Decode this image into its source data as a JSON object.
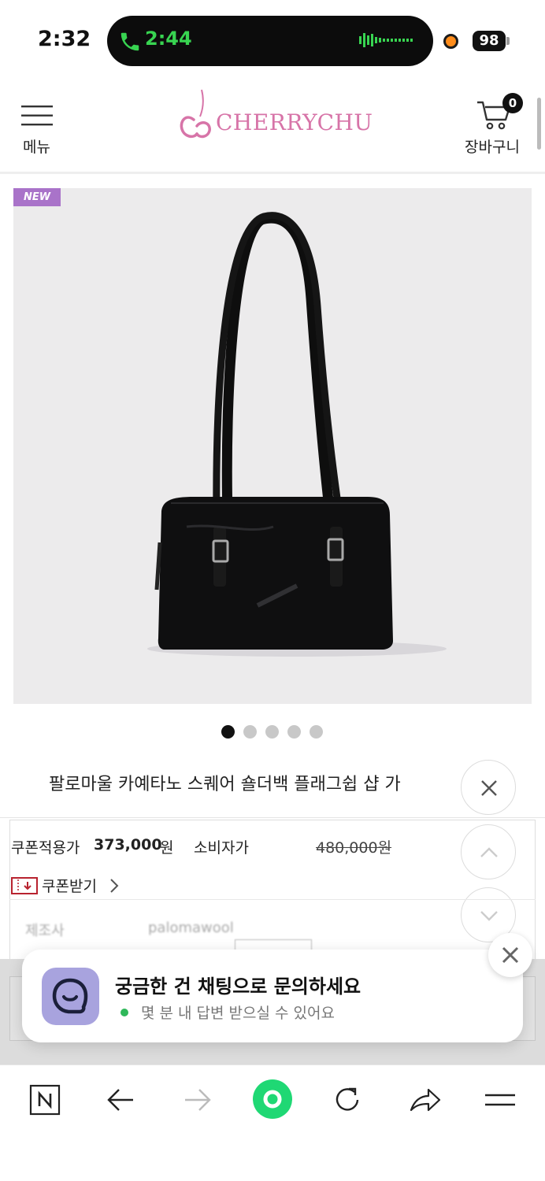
{
  "status_bar": {
    "time": "2:32",
    "call_time": "2:44",
    "battery": "98",
    "call_color": "#38d451"
  },
  "header": {
    "menu_label": "메뉴",
    "logo_text": "CHERRYCHU",
    "cart_label": "장바구니",
    "cart_count": "0",
    "brand_color": "#d774a8"
  },
  "product": {
    "badge": "NEW",
    "image_dots": 5,
    "active_dot": 0,
    "title": "팔로마울 카예타노 스퀘어 숄더백 플래그쉽 샵 가",
    "coupon_price_label": "쿠폰적용가",
    "coupon_price_value": "373,000",
    "coupon_price_unit": "원",
    "retail_label": "소비자가",
    "retail_value": "480,000원",
    "coupon_get_label": "쿠폰받기",
    "maker_label": "제조사",
    "maker_value": "palomawool"
  },
  "chat": {
    "title": "궁금한 건 채팅으로 문의하세요",
    "subtitle": "몇 분 내 답변 받으실 수 있어요"
  },
  "browser_nav": {
    "icons": [
      "naver-n-icon",
      "back-arrow-icon",
      "forward-arrow-icon",
      "home-green-icon",
      "reload-icon",
      "share-icon",
      "menu-lines-icon"
    ]
  }
}
